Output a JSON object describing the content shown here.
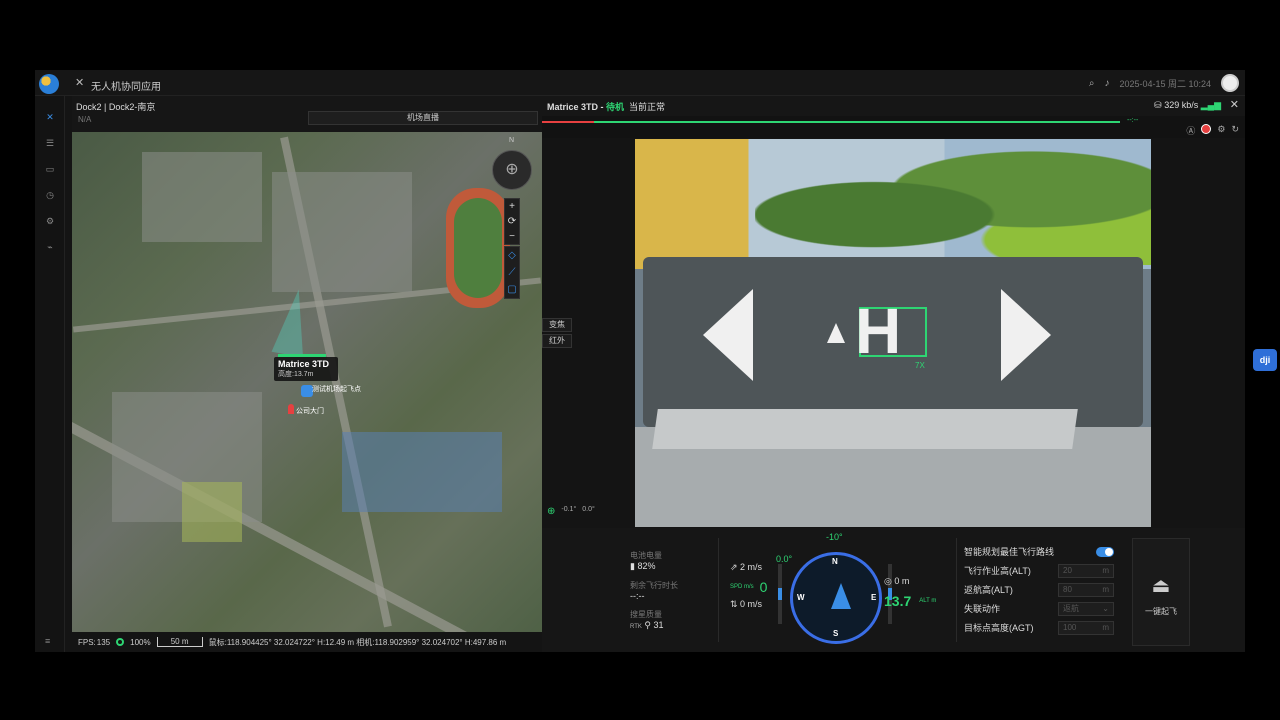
{
  "header": {
    "app_title": "无人机协同应用",
    "datetime": "2025-04-15 周二 10:24",
    "icons": [
      "search-icon",
      "bell-icon",
      "avatar"
    ]
  },
  "sidebar": {
    "items": [
      "flight-icon",
      "list-icon",
      "camera-icon",
      "history-icon",
      "settings-icon",
      "share-icon"
    ],
    "bottom": "≡"
  },
  "map_panel": {
    "dock_title": "Dock2 | Dock2-南京",
    "dock_sub": "N/A",
    "live_button": "机场直播",
    "compass_n": "N",
    "zoom_in": "+",
    "reset": "⟳",
    "zoom_out": "−",
    "drone_name": "Matrice 3TD",
    "drone_alt": "高度:13.7m",
    "dock_point": "测试机场起飞点",
    "gate_point": "公司大门",
    "fps_label": "FPS:",
    "fps": "135",
    "signal": "100%",
    "scale": "50 m",
    "coords": "鼠标:118.904425° 32.024722° H:12.49 m  相机:118.902959° 32.024702° H:497.86 m"
  },
  "video_panel": {
    "drone": "Matrice 3TD - ",
    "status": "待机",
    "status2": "当前正常",
    "bitrate": "329 kb/s",
    "close": "✕",
    "progress_end": "--:--",
    "lens_zoom": "变焦",
    "lens_ir": "红外",
    "zoom_level": "7X",
    "gimbal_pitch": "-0.1°",
    "gimbal_yaw": "0.0°",
    "hud_top_deg": "-10°"
  },
  "hud": {
    "battery_label": "电池电量",
    "battery": "82%",
    "remaining_label": "剩余飞行时长",
    "remaining": "--:--",
    "sat_label": "搜星质量",
    "rtk": "RTK",
    "sat": "31",
    "h_speed": "2 m/s",
    "v_speed": "0 m/s",
    "spd_label": "SPD\nm/s",
    "spd": "0",
    "pitch": "0.0°",
    "height_0": "0 m",
    "alt": "13.7",
    "alt_label": "ALT\nm",
    "compass_N": "N",
    "compass_E": "E",
    "compass_S": "S",
    "compass_W": "W"
  },
  "route_settings": {
    "smart_route": "智能规划最佳飞行路线",
    "work_alt_label": "飞行作业高(ALT)",
    "work_alt": "20",
    "rth_alt_label": "返航高(ALT)",
    "rth_alt": "80",
    "lost_label": "失联动作",
    "lost": "返航",
    "target_label": "目标点高度(AGT)",
    "target": "100",
    "unit": "m",
    "takeoff": "一键起飞"
  },
  "colors": {
    "accent": "#3a8ee6",
    "ok": "#2ed573",
    "alert": "#e64040"
  }
}
